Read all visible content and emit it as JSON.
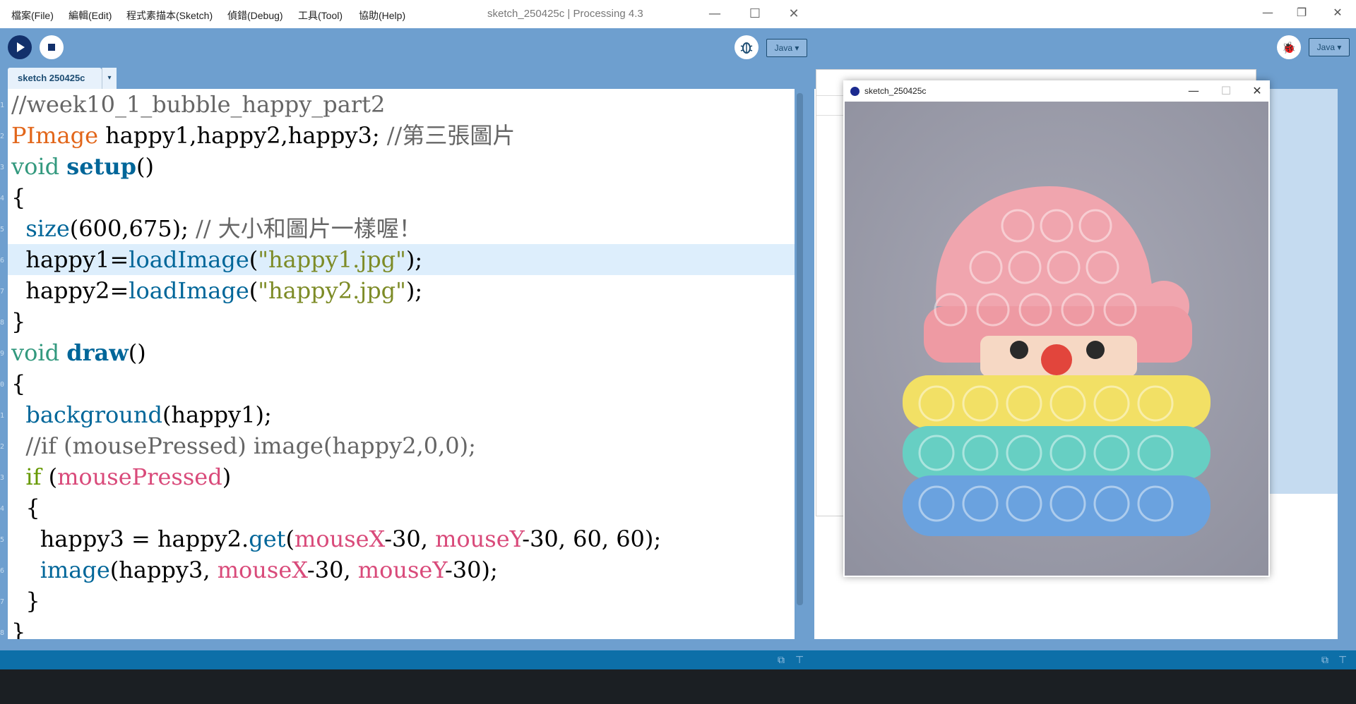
{
  "main_window": {
    "menus": [
      "檔案(File)",
      "編輯(Edit)",
      "程式素描本(Sketch)",
      "偵錯(Debug)",
      "工具(Tool)",
      "協助(Help)"
    ],
    "title": "sketch_250425c | Processing 4.3",
    "controls": {
      "minimize": "—",
      "maximize": "☐",
      "close": "✕"
    },
    "mode": "Java ▾",
    "tab": {
      "label": "sketch 250425c",
      "arrow": "▾"
    },
    "toolbar": {
      "run_icon": "play-icon",
      "stop_icon": "stop-icon",
      "debug_icon": "debugger-icon"
    }
  },
  "gutter_numbers": [
    "1",
    "2",
    "3",
    "4",
    "5",
    "6",
    "7",
    "8",
    "9",
    "0",
    "1",
    "2",
    "3",
    "4",
    "5",
    "6",
    "7",
    "8"
  ],
  "code": {
    "l1": {
      "c1": "//week10_1_bubble_happy_part2"
    },
    "l2": {
      "c1": "PImage",
      "c2": " happy1,happy2,happy3; ",
      "c3": "//第三張圖片"
    },
    "l3": {
      "c1": "void",
      "c2": " ",
      "c3": "setup",
      "c4": "()"
    },
    "l4": {
      "c1": "{"
    },
    "l5": {
      "c1": "  ",
      "c2": "size",
      "c3": "(600,675); ",
      "c4": "// 大小和圖片一樣喔！"
    },
    "l6": {
      "c1": "  happy1=",
      "c2": "loadImage",
      "c3": "(",
      "c4": "\"happy1.jpg\"",
      "c5": ");"
    },
    "l7": {
      "c1": "  happy2=",
      "c2": "loadImage",
      "c3": "(",
      "c4": "\"happy2.jpg\"",
      "c5": ");"
    },
    "l8": {
      "c1": "}"
    },
    "l9": {
      "c1": "void",
      "c2": " ",
      "c3": "draw",
      "c4": "()"
    },
    "l10": {
      "c1": "{"
    },
    "l11": {
      "c1": "  ",
      "c2": "background",
      "c3": "(happy1);"
    },
    "l12": {
      "c1": "  //if (mousePressed) image(happy2,0,0);"
    },
    "l13": {
      "c1": "  ",
      "c2": "if",
      "c3": " (",
      "c4": "mousePressed",
      "c5": ")"
    },
    "l14": {
      "c1": "  {"
    },
    "l15": {
      "c1": "    happy3 = happy2.",
      "c2": "get",
      "c3": "(",
      "c4": "mouseX",
      "c5": "-30, ",
      "c6": "mouseY",
      "c7": "-30, 60, 60);"
    },
    "l16": {
      "c1": "    ",
      "c2": "image",
      "c3": "(happy3, ",
      "c4": "mouseX",
      "c5": "-30, ",
      "c6": "mouseY",
      "c7": "-30);"
    },
    "l17": {
      "c1": "  }"
    },
    "l18": {
      "c1": "}"
    }
  },
  "sketch_window": {
    "title": "sketch_250425c",
    "controls": {
      "minimize": "—",
      "maximize": "☐",
      "close": "✕"
    },
    "image": "rainbow-santa-pop-it-toy"
  },
  "background_window": {
    "controls": {
      "minimize": "—",
      "restore": "❐",
      "close": "✕"
    },
    "mode": "Java ▾"
  },
  "colors": {
    "accent": "#6e9fcf",
    "status": "#0d6fa8",
    "console": "#1b1f23",
    "line_highlight": "#ddeefc"
  }
}
